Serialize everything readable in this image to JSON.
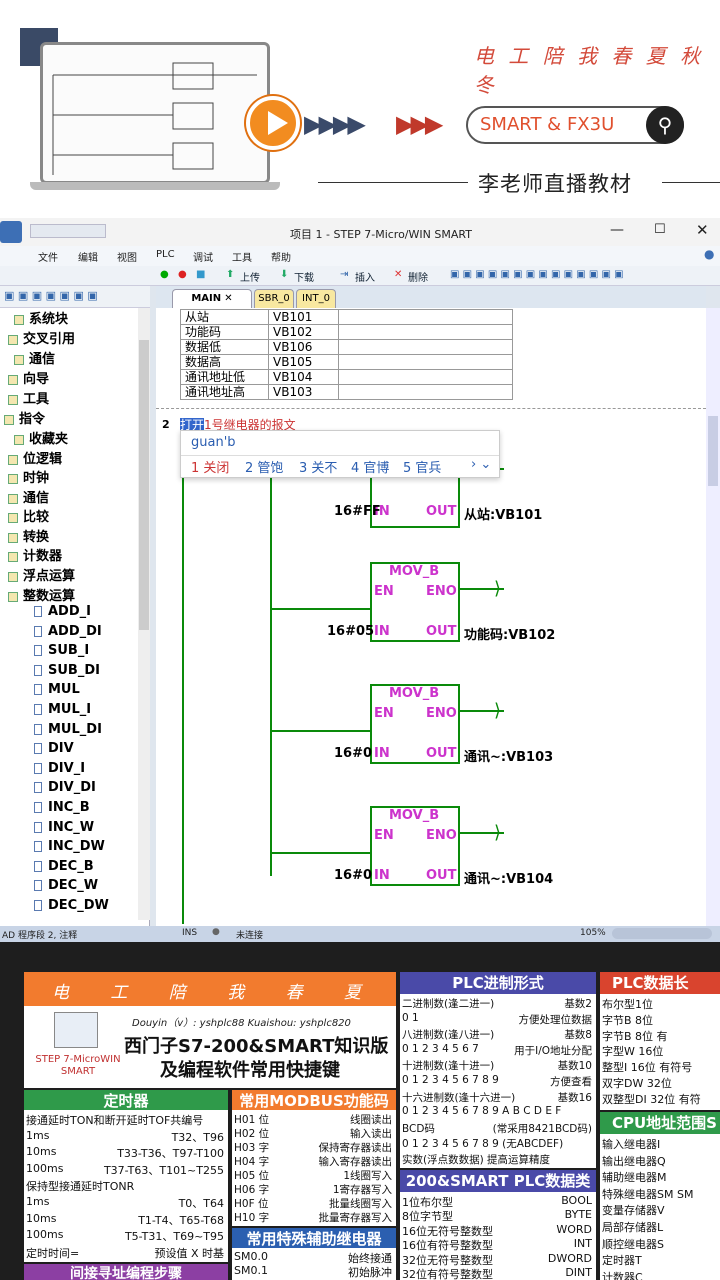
{
  "banner": {
    "slogan": "电 工 陪 我 春 夏 秋 冬",
    "search_text": "SMART & FX3U",
    "teacher": "李老师直播教材"
  },
  "window": {
    "title": "项目 1 - STEP 7-Micro/WIN SMART",
    "menus": [
      "文件",
      "编辑",
      "视图",
      "PLC",
      "调试",
      "工具",
      "帮助"
    ],
    "toolbar": {
      "upload": "上传",
      "download": "下载",
      "insert": "插入",
      "delete": "删除"
    },
    "tabs": [
      "MAIN",
      "SBR_0",
      "INT_0"
    ],
    "status": {
      "left": "AD 程序段 2, 注释",
      "ins": "INS",
      "conn": "未连接",
      "zoom": "105%"
    }
  },
  "tree": {
    "items": [
      "系统块",
      "交叉引用",
      "通信",
      "向导",
      "工具",
      "指令",
      "收藏夹",
      "位逻辑",
      "时钟",
      "通信",
      "比较",
      "转换",
      "计数器",
      "浮点运算",
      "整数运算"
    ],
    "leaves": [
      "ADD_I",
      "ADD_DI",
      "SUB_I",
      "SUB_DI",
      "MUL",
      "MUL_I",
      "MUL_DI",
      "DIV",
      "DIV_I",
      "DIV_DI",
      "INC_B",
      "INC_W",
      "INC_DW",
      "DEC_B",
      "DEC_W",
      "DEC_DW"
    ]
  },
  "symbols": [
    [
      "从站",
      "VB101"
    ],
    [
      "功能码",
      "VB102"
    ],
    [
      "数据低",
      "VB106"
    ],
    [
      "数据高",
      "VB105"
    ],
    [
      "通讯地址低",
      "VB104"
    ],
    [
      "通讯地址高",
      "VB103"
    ]
  ],
  "network": {
    "num": "2",
    "comment_sel": "打开",
    "comment_rest": "1号继电器的报文",
    "ime_input": "guan'b",
    "ime_candidates": [
      "1 关闭",
      "2 管饱",
      "3 关不",
      "4 官博",
      "5 官兵"
    ],
    "ime_more": "› ⌄",
    "boxes": [
      {
        "title": "MOV_B",
        "en": "EN",
        "eno": "ENO",
        "in": "IN",
        "out": "OUT",
        "in_val": "16#FF",
        "out_val": "从站:VB101"
      },
      {
        "title": "MOV_B",
        "en": "EN",
        "eno": "ENO",
        "in": "IN",
        "out": "OUT",
        "in_val": "16#05",
        "out_val": "功能码:VB102"
      },
      {
        "title": "MOV_B",
        "en": "EN",
        "eno": "ENO",
        "in": "IN",
        "out": "OUT",
        "in_val": "16#0",
        "out_val": "通讯~:VB103"
      },
      {
        "title": "MOV_B",
        "en": "EN",
        "eno": "ENO",
        "in": "IN",
        "out": "OUT",
        "in_val": "16#0",
        "out_val": "通讯~:VB104"
      }
    ]
  },
  "sheet": {
    "slogan": "电 工 陪 我 春 夏 秋 冬",
    "douyin": "Douyin（v）: yshplc88   Kuaishou: yshplc820",
    "logo": "STEP 7-MicroWIN SMART",
    "title1": "西门子S7-200&SMART知识版",
    "title2": "及编程软件常用快捷键",
    "timer_head": "定时器",
    "timer_lines": [
      [
        "接通延时TON和断开延时TOF共编号",
        ""
      ],
      [
        "1ms",
        "T32、T96"
      ],
      [
        "10ms",
        "T33-T36、T97-T100"
      ],
      [
        "100ms",
        "T37-T63、T101~T255"
      ],
      [
        "保持型接通延时TONR",
        ""
      ],
      [
        "1ms",
        "T0、T64"
      ],
      [
        "10ms",
        "T1-T4、T65-T68"
      ],
      [
        "100ms",
        "T5-T31、T69~T95"
      ],
      [
        "定时时间=",
        "预设值 X 时基"
      ]
    ],
    "modbus_head": "常用MODBUS功能码",
    "modbus_lines": [
      [
        "H01 位",
        "线圈读出"
      ],
      [
        "H02 位",
        "输入读出"
      ],
      [
        "H03 字",
        "保持寄存器读出"
      ],
      [
        "H04 字",
        "输入寄存器读出"
      ],
      [
        "H05 位",
        "1线圈写入"
      ],
      [
        "H06 字",
        "1寄存器写入"
      ],
      [
        "H0F 位",
        "批量线圈写入"
      ],
      [
        "H10 字",
        "批量寄存器写入"
      ]
    ],
    "special_head": "常用特殊辅助继电器",
    "special_lines": [
      [
        "SM0.0",
        "始终接通"
      ],
      [
        "SM0.1",
        "初始脉冲"
      ]
    ],
    "indirect_head": "间接寻址编程步骤",
    "base_head": "PLC进制形式",
    "base_lines": [
      [
        "二进制数(逢二进一)",
        "基数2"
      ],
      [
        "0 1",
        "方便处理位数据"
      ],
      [
        "八进制数(逢八进一)",
        "基数8"
      ],
      [
        "0 1 2 3 4 5 6 7",
        "用于I/O地址分配"
      ],
      [
        "十进制数(逢十进一)",
        "基数10"
      ],
      [
        "0 1 2 3 4 5 6 7 8 9",
        "方便查看"
      ],
      [
        "十六进制数(逢十六进一)",
        "基数16"
      ],
      [
        "0 1 2 3 4 5 6 7 8 9 A B C D E F",
        ""
      ],
      [
        "BCD码",
        "(常采用8421BCD码)"
      ],
      [
        "0 1 2 3 4 5 6 7 8 9 (无ABCDEF)",
        ""
      ],
      [
        "实数(浮点数数据) 提高运算精度",
        ""
      ]
    ],
    "dtype_head": "200&SMART PLC数据类型",
    "dtype_lines": [
      [
        "1位布尔型",
        "BOOL"
      ],
      [
        "8位字节型",
        "BYTE"
      ],
      [
        "16位无符号整数型",
        "WORD"
      ],
      [
        "16位有符号整数型",
        "INT"
      ],
      [
        "32位无符号整数型",
        "DWORD"
      ],
      [
        "32位有符号整数型",
        "DINT"
      ]
    ],
    "len_head": "PLC数据长",
    "len_lines": [
      "布尔型1位",
      "字节B 8位",
      "字节B 8位          有",
      "字型W 16位",
      "整型I 16位      有符号",
      "双字DW 32位",
      "双整型DI 32位     有符"
    ],
    "cpu_head": "CPU地址范围S",
    "cpu_lines": [
      "输入继电器I",
      "输出继电器Q",
      "辅助继电器M",
      "特殊继电器SM           SM",
      "变量存储器V",
      "局部存储器L",
      "顺控继电器S",
      "定时器T",
      "计数器C"
    ]
  }
}
